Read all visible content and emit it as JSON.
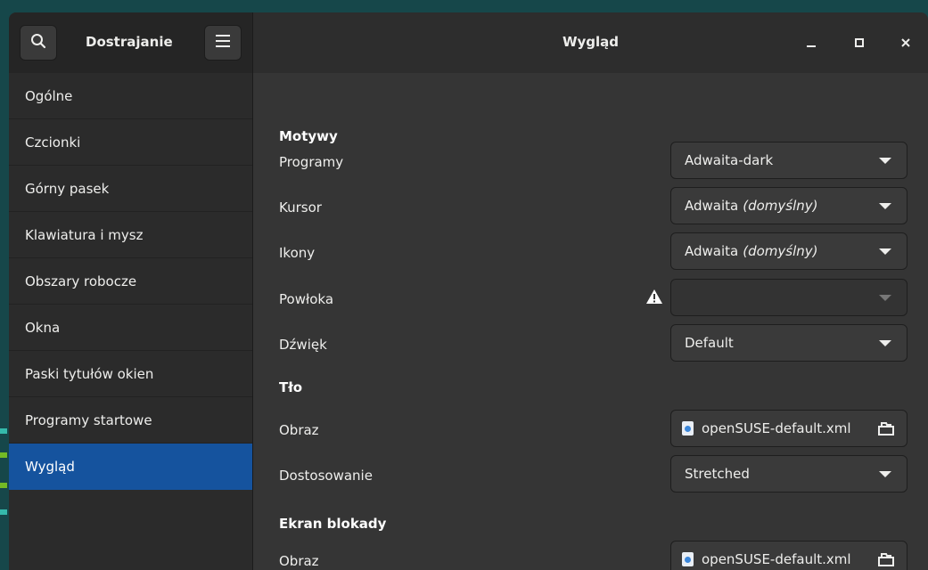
{
  "window": {
    "app_title": "Dostrajanie",
    "page_title": "Wygląd"
  },
  "icons": {
    "search": "search-icon",
    "menu": "hamburger-menu-icon",
    "minimize": "minimize-icon",
    "maximize": "maximize-icon",
    "close": "close-icon",
    "warning": "warning-icon",
    "file": "xml-file-icon",
    "open": "open-folder-icon"
  },
  "colors": {
    "accent": "#15539e",
    "sidebar_bg": "#2b2b2b",
    "content_bg": "#353535"
  },
  "sidebar": {
    "items": [
      {
        "label": "Ogólne"
      },
      {
        "label": "Czcionki"
      },
      {
        "label": "Górny pasek"
      },
      {
        "label": "Klawiatura i mysz"
      },
      {
        "label": "Obszary robocze"
      },
      {
        "label": "Okna"
      },
      {
        "label": "Paski tytułów okien"
      },
      {
        "label": "Programy startowe"
      },
      {
        "label": "Wygląd",
        "active": true
      }
    ]
  },
  "themes": {
    "title": "Motywy",
    "applications": {
      "label": "Programy",
      "value": "Adwaita-dark"
    },
    "cursor": {
      "label": "Kursor",
      "value": "Adwaita",
      "suffix": "(domyślny)"
    },
    "icons": {
      "label": "Ikony",
      "value": "Adwaita",
      "suffix": "(domyślny)"
    },
    "shell": {
      "label": "Powłoka",
      "value": ""
    },
    "sound": {
      "label": "Dźwięk",
      "value": "Default"
    }
  },
  "background": {
    "title": "Tło",
    "image": {
      "label": "Obraz",
      "value": "openSUSE-default.xml"
    },
    "adjustment": {
      "label": "Dostosowanie",
      "value": "Stretched"
    }
  },
  "lockscreen": {
    "title": "Ekran blokady",
    "image": {
      "label": "Obraz",
      "value": "openSUSE-default.xml"
    }
  }
}
